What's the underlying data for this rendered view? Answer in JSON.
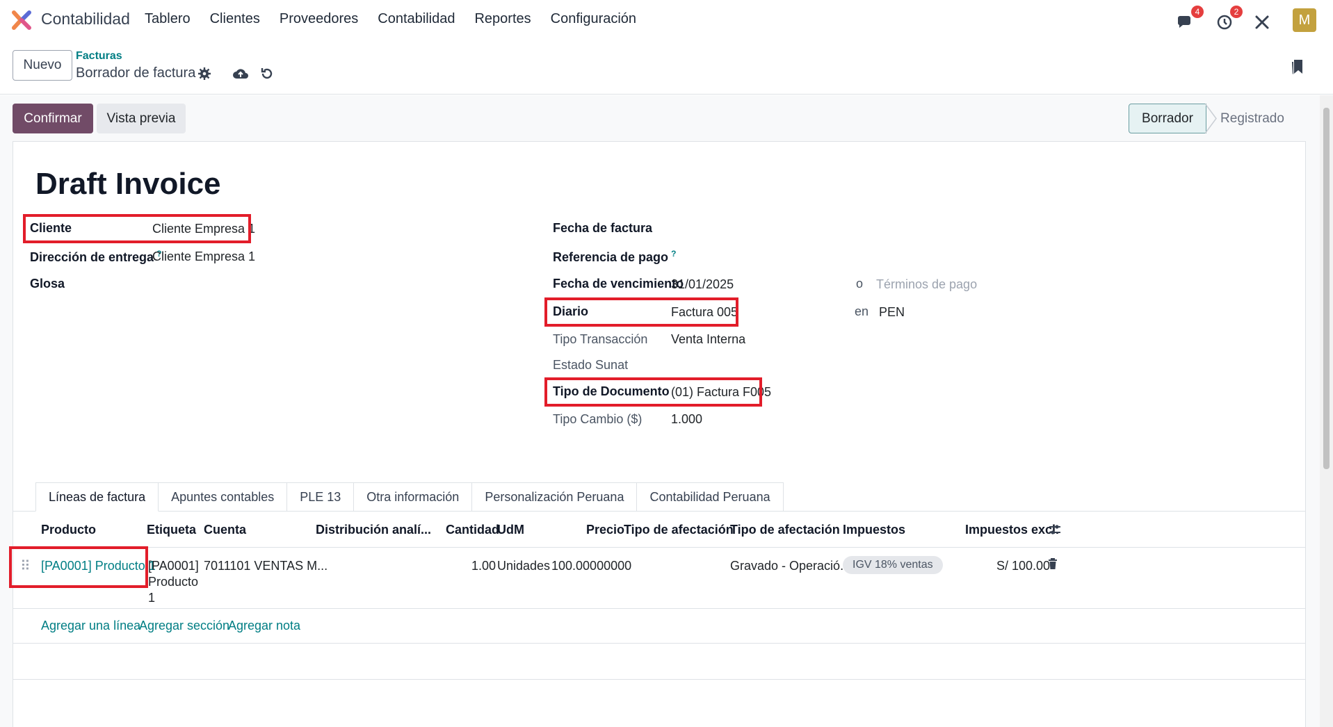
{
  "app": {
    "name": "Contabilidad"
  },
  "menu": {
    "items": [
      "Tablero",
      "Clientes",
      "Proveedores",
      "Contabilidad",
      "Reportes",
      "Configuración"
    ]
  },
  "systray": {
    "messages_badge": "4",
    "activities_badge": "2",
    "avatar_letter": "M"
  },
  "control": {
    "new_label": "Nuevo",
    "breadcrumb_parent": "Facturas",
    "breadcrumb_current": "Borrador de factura"
  },
  "actions": {
    "confirm_label": "Confirmar",
    "preview_label": "Vista previa"
  },
  "status": {
    "active": "Borrador",
    "next": "Registrado"
  },
  "form": {
    "title": "Draft Invoice",
    "left": {
      "cliente_label": "Cliente",
      "cliente_value": "Cliente Empresa 1",
      "direccion_label": "Dirección de entrega",
      "direccion_help": "?",
      "direccion_value": "Cliente Empresa 1",
      "glosa_label": "Glosa"
    },
    "right": {
      "fecha_factura_label": "Fecha de factura",
      "ref_pago_label": "Referencia de pago",
      "ref_pago_help": "?",
      "vencimiento_label": "Fecha de vencimiento",
      "vencimiento_value": "31/01/2025",
      "o_label": "o",
      "terminos_placeholder": "Términos de pago",
      "diario_label": "Diario",
      "diario_value": "Factura 005",
      "en_label": "en",
      "currency_value": "PEN",
      "tipo_transaccion_label": "Tipo Transacción",
      "tipo_transaccion_value": "Venta Interna",
      "estado_sunat_label": "Estado Sunat",
      "tipo_documento_label": "Tipo de Documento",
      "tipo_documento_value": "(01) Factura F005",
      "tipo_cambio_label": "Tipo Cambio ($)",
      "tipo_cambio_value": "1.000"
    }
  },
  "tabs": [
    "Líneas de factura",
    "Apuntes contables",
    "PLE 13",
    "Otra información",
    "Personalización Peruana",
    "Contabilidad Peruana"
  ],
  "lines": {
    "headers": [
      "Producto",
      "Etiqueta",
      "Cuenta",
      "Distribución analí...",
      "Cantidad",
      "UdM",
      "Precio",
      "Tipo de afectación",
      "Tipo de afectación",
      "Impuestos",
      "Impuestos excl."
    ],
    "rows": [
      {
        "producto": "[PA0001] Producto 1",
        "etiqueta_1": "[PA0001]",
        "etiqueta_2": "Producto",
        "etiqueta_3": "1",
        "cuenta": "7011101 VENTAS M...",
        "cantidad": "1.00",
        "udm": "Unidades",
        "precio": "100.00000000",
        "tipo_afectacion": "Gravado - Operació...",
        "impuestos": "IGV 18% ventas",
        "subtotal": "S/ 100.00"
      }
    ],
    "add_line": "Agregar una línea",
    "add_section": "Agregar sección",
    "add_note": "Agregar nota"
  },
  "colors": {
    "primary": "#714b67",
    "link": "#017e84",
    "highlight": "#e21d2a"
  }
}
